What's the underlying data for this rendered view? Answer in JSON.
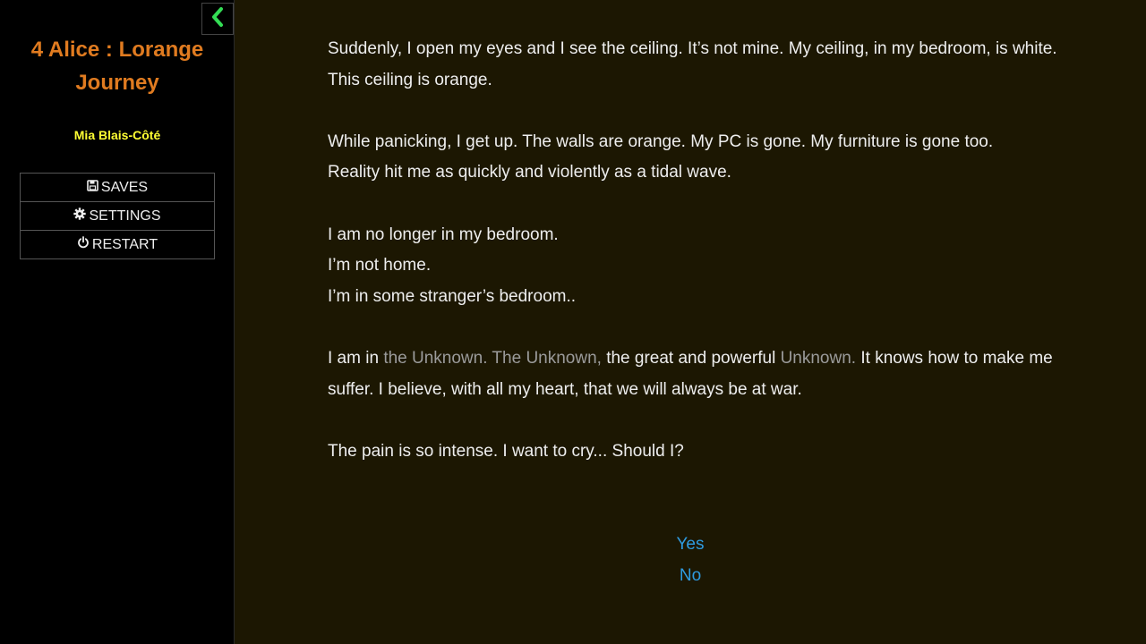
{
  "sidebar": {
    "title": "4 Alice : Lorange Journey",
    "author": "Mia Blais-Côté",
    "collapse_icon": "chevron-left-icon",
    "menu": {
      "saves_label": "SAVES",
      "settings_label": "SETTINGS",
      "restart_label": "RESTART"
    }
  },
  "passage": {
    "p1_line1": "Suddenly, I open my eyes and I see the ceiling. It’s not mine. My ceiling, in my bedroom, is white.",
    "p1_line2": "This ceiling is orange.",
    "p2_line1": "While panicking, I get up. The walls are orange. My PC is gone. My furniture is gone too.",
    "p2_line2": "Reality hit me as quickly and violently as a tidal wave.",
    "p3_line1": "I am no longer in my bedroom.",
    "p3_line2": "I’m not home.",
    "p3_line3": "I’m in some stranger’s bedroom..",
    "p4_a": "I am in ",
    "p4_b": "the Unknown. The Unknown,",
    "p4_c": " the great and powerful ",
    "p4_d": "Unknown.",
    "p4_e": " It knows how to make me suffer. I believe, with all my heart, that we will always be at war.",
    "p5": "The pain is so intense. I want to cry... Should I?"
  },
  "choices": {
    "yes": "Yes",
    "no": "No"
  },
  "colors": {
    "background": "#1c1702",
    "sidebar": "#000000",
    "title": "#e07b20",
    "author": "#ffff33",
    "link": "#2e9be0",
    "accent_icon": "#33dd55",
    "dim_text": "#9b9b9b"
  }
}
